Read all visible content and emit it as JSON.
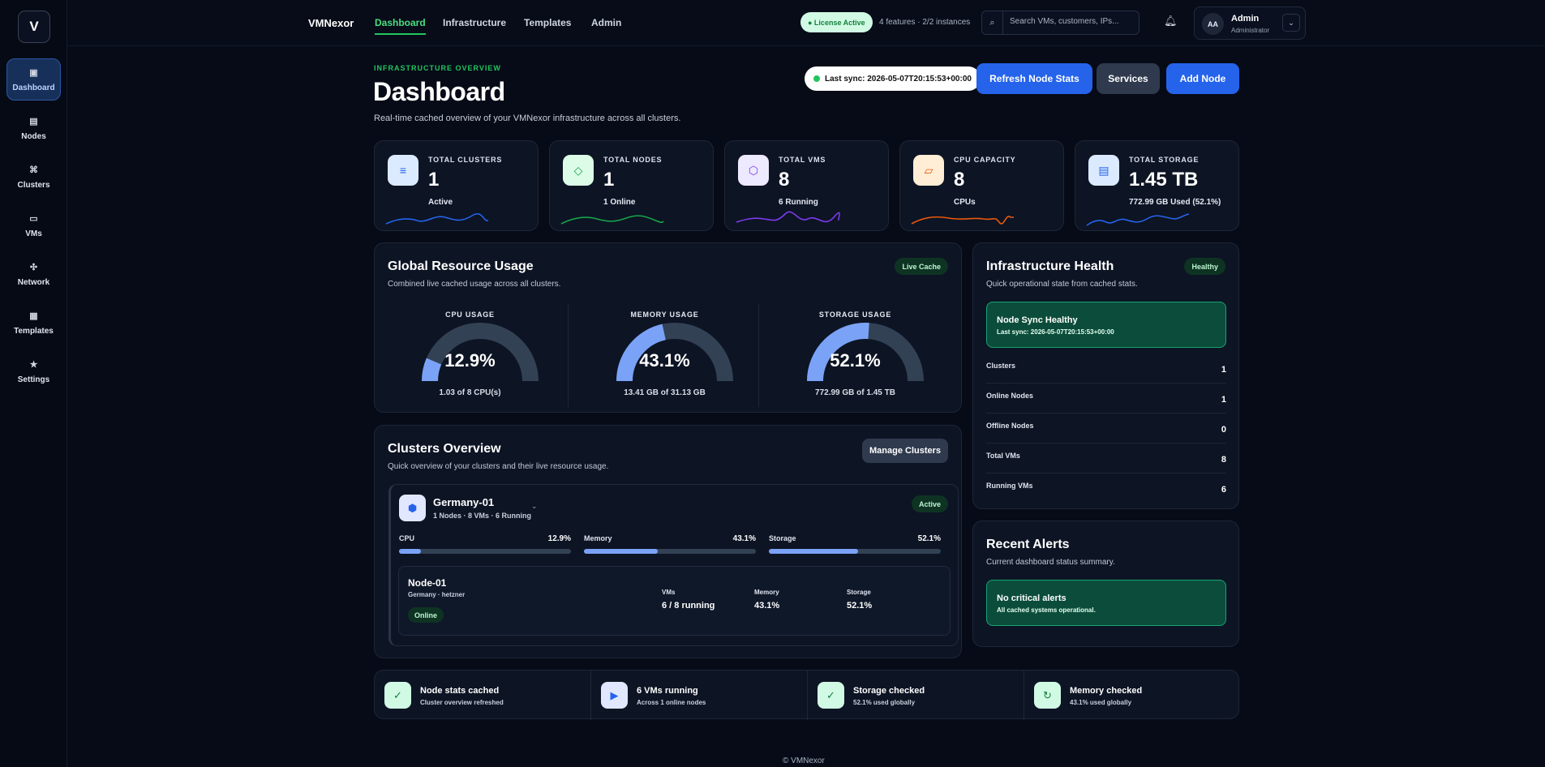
{
  "sidebar": {
    "logo": "V",
    "items": [
      {
        "label": "Dashboard",
        "icon": "▣"
      },
      {
        "label": "Nodes",
        "icon": "▤"
      },
      {
        "label": "Clusters",
        "icon": "⌘"
      },
      {
        "label": "VMs",
        "icon": "▭"
      },
      {
        "label": "Network",
        "icon": "✣"
      },
      {
        "label": "Templates",
        "icon": "▦"
      },
      {
        "label": "Settings",
        "icon": "★"
      }
    ]
  },
  "topbar": {
    "brand": "VMNexor",
    "tabs": [
      "Dashboard",
      "Infrastructure",
      "Templates",
      "Admin"
    ],
    "license": "● License Active",
    "features": "4 features · 2/2 instances",
    "search_placeholder": "Search VMs, customers, IPs...",
    "user": {
      "initials": "AA",
      "name": "Admin",
      "role": "Administrator"
    }
  },
  "header": {
    "eyebrow": "INFRASTRUCTURE OVERVIEW",
    "title": "Dashboard",
    "subtitle": "Real-time cached overview of your VMNexor infrastructure across all clusters.",
    "sync": "Last sync: 2026-05-07T20:15:53+00:00",
    "buttons": {
      "refresh": "Refresh Node Stats",
      "services": "Services",
      "add": "Add Node"
    }
  },
  "stats": [
    {
      "label": "TOTAL CLUSTERS",
      "value": "1",
      "sub": "Active",
      "color": "#2563eb",
      "icon": "≡"
    },
    {
      "label": "TOTAL NODES",
      "value": "1",
      "sub": "1 Online",
      "color": "#16a34a",
      "icon": "◇"
    },
    {
      "label": "TOTAL VMS",
      "value": "8",
      "sub": "6 Running",
      "color": "#7c3aed",
      "icon": "⬡"
    },
    {
      "label": "CPU CAPACITY",
      "value": "8",
      "sub": "CPUs",
      "color": "#ea580c",
      "icon": "▱"
    },
    {
      "label": "TOTAL STORAGE",
      "value": "1.45 TB",
      "sub": "772.99 GB Used (52.1%)",
      "color": "#2563eb",
      "icon": "▤"
    }
  ],
  "resource": {
    "title": "Global Resource Usage",
    "subtitle": "Combined live cached usage across all clusters.",
    "badge": "Live Cache",
    "gauges": [
      {
        "label": "CPU USAGE",
        "percent": 12.9,
        "value": "12.9%",
        "sub": "1.03 of 8 CPU(s)"
      },
      {
        "label": "MEMORY USAGE",
        "percent": 43.1,
        "value": "43.1%",
        "sub": "13.41 GB of 31.13 GB"
      },
      {
        "label": "STORAGE USAGE",
        "percent": 52.1,
        "value": "52.1%",
        "sub": "772.99 GB of 1.45 TB"
      }
    ]
  },
  "health": {
    "title": "Infrastructure Health",
    "subtitle": "Quick operational state from cached stats.",
    "badge": "Healthy",
    "box_title": "Node Sync Healthy",
    "box_sub": "Last sync: 2026-05-07T20:15:53+00:00",
    "rows": [
      {
        "k": "Clusters",
        "v": "1"
      },
      {
        "k": "Online Nodes",
        "v": "1"
      },
      {
        "k": "Offline Nodes",
        "v": "0"
      },
      {
        "k": "Total VMs",
        "v": "8"
      },
      {
        "k": "Running VMs",
        "v": "6"
      }
    ]
  },
  "clusters": {
    "title": "Clusters Overview",
    "subtitle": "Quick overview of your clusters and their live resource usage.",
    "manage": "Manage Clusters",
    "cluster": {
      "name": "Germany-01",
      "meta": "1 Nodes · 8 VMs · 6 Running",
      "status": "Active",
      "bars": [
        {
          "label": "CPU",
          "value": "12.9%",
          "percent": 12.9
        },
        {
          "label": "Memory",
          "value": "43.1%",
          "percent": 43.1
        },
        {
          "label": "Storage",
          "value": "52.1%",
          "percent": 52.1
        }
      ],
      "node": {
        "name": "Node-01",
        "location": "Germany · hetzner",
        "status": "Online",
        "vms_label": "VMs",
        "vms": "6 / 8 running",
        "mem_label": "Memory",
        "mem": "43.1%",
        "sto_label": "Storage",
        "sto": "52.1%"
      }
    }
  },
  "alerts": {
    "title": "Recent Alerts",
    "subtitle": "Current dashboard status summary.",
    "box_title": "No critical alerts",
    "box_sub": "All cached systems operational."
  },
  "footer_strip": [
    {
      "title": "Node stats cached",
      "sub": "Cluster overview refreshed",
      "icon": "✓"
    },
    {
      "title": "6 VMs running",
      "sub": "Across 1 online nodes",
      "icon": "▶"
    },
    {
      "title": "Storage checked",
      "sub": "52.1% used globally",
      "icon": "✓"
    },
    {
      "title": "Memory checked",
      "sub": "43.1% used globally",
      "icon": "↻"
    }
  ],
  "copyright": "© VMNexor"
}
